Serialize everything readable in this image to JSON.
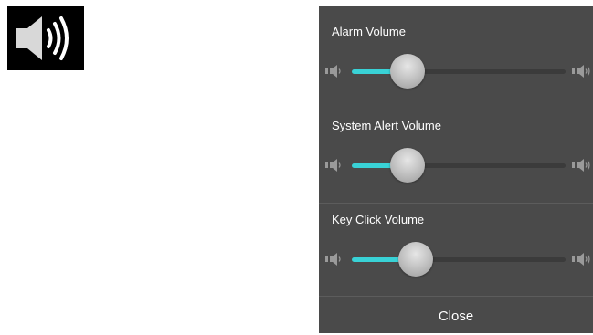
{
  "icons": {
    "speaker": "speaker-volume-icon",
    "volume_low": "volume-low-icon",
    "volume_high": "volume-high-icon"
  },
  "colors": {
    "panel": "#4a4a4a",
    "accent": "#39d2d6",
    "track": "#3b3b3b",
    "icon": "#9a9a9a"
  },
  "volume_panel": {
    "sliders": [
      {
        "label": "Alarm Volume",
        "level": 0.26
      },
      {
        "label": "System Alert Volume",
        "level": 0.26
      },
      {
        "label": "Key Click Volume",
        "level": 0.3
      }
    ],
    "close_label": "Close"
  }
}
